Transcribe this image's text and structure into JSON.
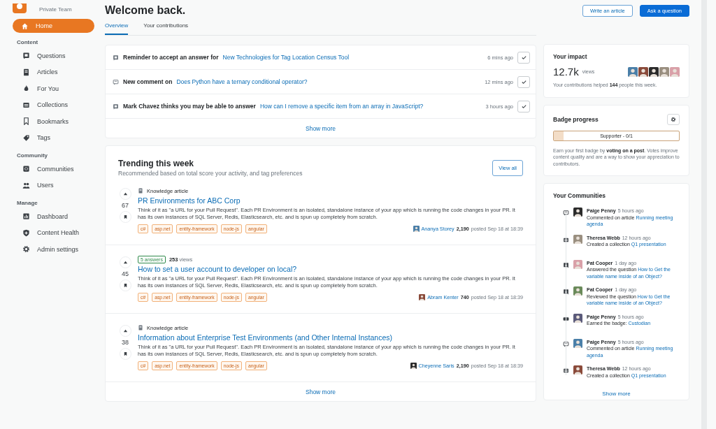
{
  "team": {
    "subtitle": "Private Team"
  },
  "nav": [
    {
      "items": [
        {
          "label": "Home",
          "kind": "home",
          "selected": true
        }
      ]
    },
    {
      "heading": "Content",
      "items": [
        {
          "label": "Questions",
          "kind": "question",
          "selected": false
        },
        {
          "label": "Articles",
          "kind": "article",
          "selected": false
        },
        {
          "label": "For You",
          "kind": "fire",
          "selected": false
        },
        {
          "label": "Collections",
          "kind": "collection",
          "selected": false
        },
        {
          "label": "Bookmarks",
          "kind": "bookmark",
          "selected": false
        },
        {
          "label": "Tags",
          "kind": "tag",
          "selected": false
        }
      ]
    },
    {
      "heading": "Community",
      "items": [
        {
          "label": "Communities",
          "kind": "community",
          "selected": false
        },
        {
          "label": "Users",
          "kind": "users",
          "selected": false
        }
      ]
    },
    {
      "heading": "Manage",
      "items": [
        {
          "label": "Dashboard",
          "kind": "dashboard",
          "selected": false
        },
        {
          "label": "Content Health",
          "kind": "health",
          "selected": false
        },
        {
          "label": "Admin settings",
          "kind": "gear",
          "selected": false
        }
      ]
    }
  ],
  "header": {
    "title": "Welcome back.",
    "buttons": [
      {
        "label": "Write an article",
        "kind": "secondary"
      },
      {
        "label": "Ask a question",
        "kind": "primary"
      }
    ]
  },
  "tabs": [
    {
      "label": "Overview",
      "selected": true
    },
    {
      "label": "Your contributions",
      "selected": false
    }
  ],
  "notifications": {
    "items": [
      {
        "kind": "question",
        "lead": "Reminder to accept an answer for",
        "link": "New Technologies for Tag Location Census Tool",
        "time": "6 mins ago"
      },
      {
        "kind": "comment",
        "lead": "New comment on",
        "link": "Does Python have a ternary conditional operator?",
        "time": "12 mins ago"
      },
      {
        "kind": "question",
        "lead": "Mark Chavez thinks you may be able to answer",
        "link": "How can I remove a specific item from an array in JavaScript?",
        "time": "3 hours ago"
      }
    ],
    "show_more": "Show more"
  },
  "trending": {
    "title": "Trending this week",
    "subtitle": "Recommended based on total score your activity, and tag preferences",
    "view_all": "View all",
    "posts": [
      {
        "kind": "article",
        "type_label": "Knowledge article",
        "votes": "67",
        "title": "PR Environments for ABC Corp",
        "excerpt": "Think of it as \"a URL for your Pull Request\". Each PR Environment is an isolated, standalone instance of your app which is running the code changes in your PR. It has its own instances of SQL Server, Redis, Elasticsearch, etc. and is spun up completely from scratch.",
        "tags": [
          "c#",
          "asp.net",
          "entity-framework",
          "node-js",
          "angular"
        ],
        "author": "Ananya Storey",
        "rep": "2,190",
        "posted": "posted Sep 18 at 18:39"
      },
      {
        "kind": "question",
        "answers": "5 answers",
        "views": "253",
        "views_label": "views",
        "votes": "45",
        "title": "How to set a user account to developer on local?",
        "excerpt": "Think of it as \"a URL for your Pull Request\". Each PR Environment is an isolated, standalone instance of your app which is running the code changes in your PR. It has its own instances of SQL Server, Redis, Elasticsearch, etc. and is spun up completely from scratch.",
        "tags": [
          "c#",
          "asp.net",
          "entity-framework",
          "node-js",
          "angular"
        ],
        "author": "Abram Kenter",
        "rep": "740",
        "posted": "posted Sep 18 at 18:39"
      },
      {
        "kind": "article",
        "type_label": "Knowledge article",
        "votes": "38",
        "title": "Information about Enterprise Test Environments (and Other Internal Instances)",
        "excerpt": "Think of it as \"a URL for your Pull Request\". Each PR Environment is an isolated, standalone instance of your app which is running the code changes in your PR. It has its own instances of SQL Server, Redis, Elasticsearch, etc. and is spun up completely from scratch.",
        "tags": [
          "c#",
          "asp.net",
          "entity-framework",
          "node-js",
          "angular"
        ],
        "author": "Cheyenne Saris",
        "rep": "2,190",
        "posted": "posted Sep 18 at 18:39"
      }
    ],
    "show_more": "Show more"
  },
  "impact": {
    "title": "Your impact",
    "count": "12.7k",
    "unit": "views",
    "text": "Your contributions helped **144** people this week."
  },
  "badge": {
    "title": "Badge progress",
    "label": "Supporter - 0/1",
    "level": 0.08,
    "text": "Earn your first badge by **voting on a post**. Votes improve content quality and are a way to show your appreciation to contributors."
  },
  "communities": {
    "title": "Your Communities",
    "items": [
      {
        "kind": "comment",
        "name": "Paige Penny",
        "time": "5 hours ago",
        "action": "Commented on article",
        "link": "Running meeting agenda"
      },
      {
        "kind": "collection",
        "name": "Theresa Webb",
        "time": "12 hours ago",
        "action": "Created a collection",
        "link": "Q1 presentation"
      },
      {
        "kind": "answer",
        "name": "Pat Cooper",
        "time": "1 day ago",
        "action": "Answered the question",
        "link": "How to Get the variable name inside of an Object?"
      },
      {
        "kind": "answer",
        "name": "Pat Cooper",
        "time": "1 day ago",
        "action": "Reviewed the question",
        "link": "How to Get the variable name inside of an Object?"
      },
      {
        "kind": "badge",
        "name": "Paige Penny",
        "time": "5 hours ago",
        "action": "Earned the badge:",
        "link": "Custodian"
      },
      {
        "kind": "comment",
        "name": "Paige Penny",
        "time": "5 hours ago",
        "action": "Commented on article",
        "link": "Running meeting agenda"
      },
      {
        "kind": "collection",
        "name": "Theresa Webb",
        "time": "12 hours ago",
        "action": "Created a collection",
        "link": "Q1 presentation"
      }
    ],
    "show_more": "Show more"
  }
}
